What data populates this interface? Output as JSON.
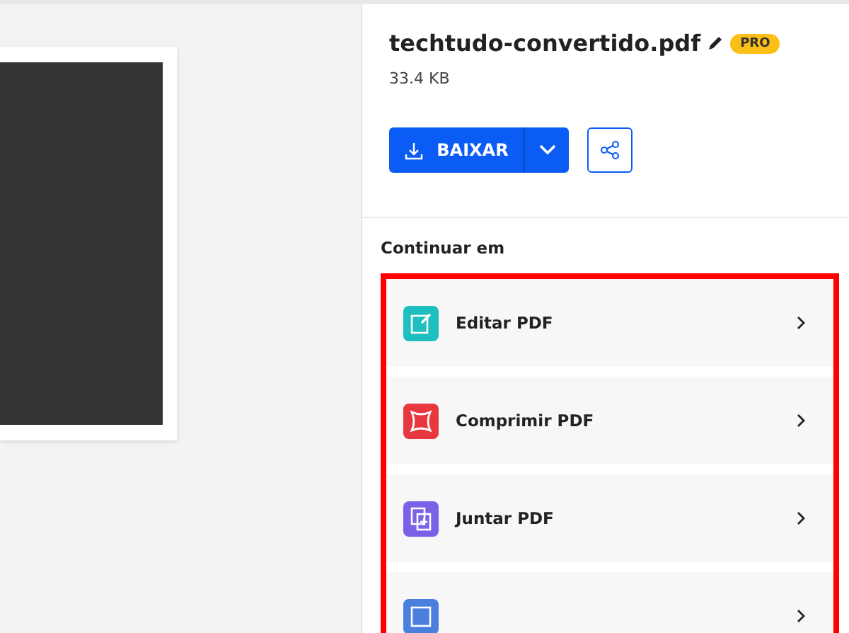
{
  "file": {
    "name": "techtudo-convertido.pdf",
    "badge": "PRO",
    "size": "33.4 KB"
  },
  "download": {
    "label": "BAIXAR"
  },
  "continue": {
    "heading": "Continuar em",
    "highlighted": true,
    "items": [
      {
        "kind": "edit",
        "label": "Editar PDF",
        "color": "#1fbfbf"
      },
      {
        "kind": "compress",
        "label": "Comprimir PDF",
        "color": "#e8373f"
      },
      {
        "kind": "merge",
        "label": "Juntar PDF",
        "color": "#7b61e8"
      },
      {
        "kind": "word",
        "color": "#4a7fe0"
      }
    ]
  }
}
